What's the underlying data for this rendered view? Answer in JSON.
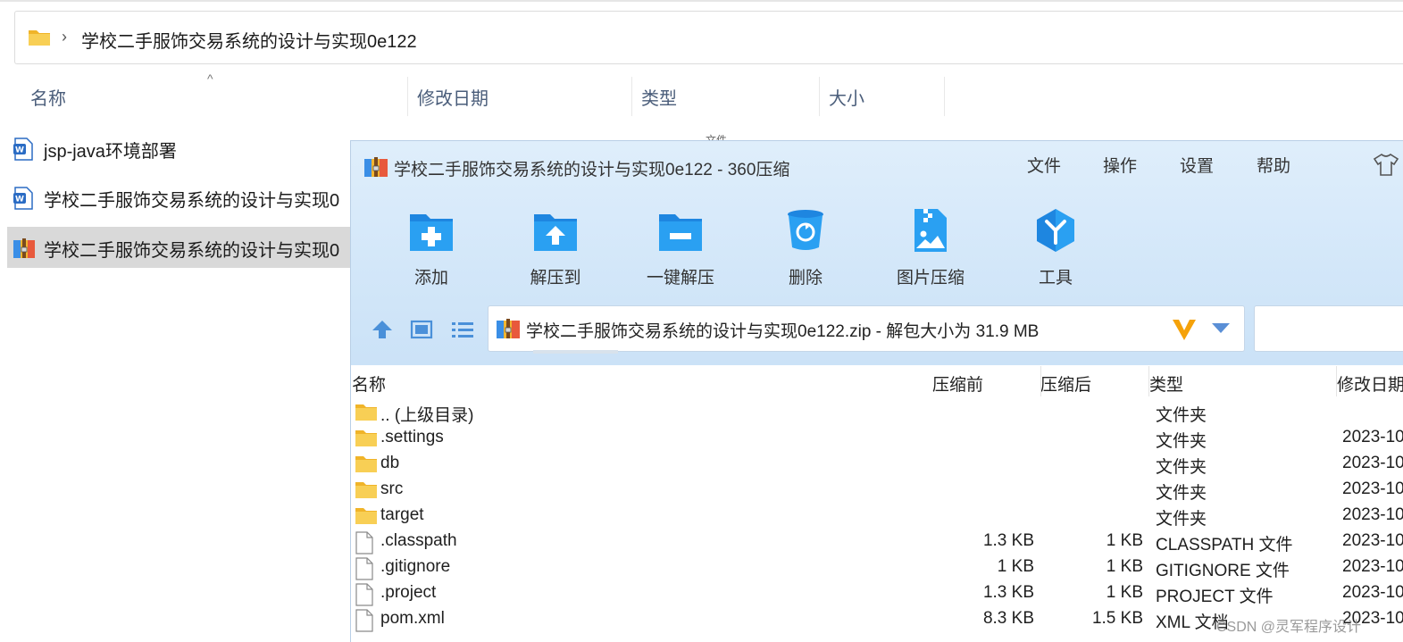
{
  "explorer": {
    "breadcrumb_path": "学校二手服饰交易系统的设计与实现0e122",
    "breadcrumb_separator": "›",
    "columns": {
      "name": "名称",
      "modified": "修改日期",
      "type": "类型",
      "size": "大小"
    },
    "sort_indicator": "^",
    "rows": [
      {
        "icon": "word-doc-icon",
        "name": "jsp-java环境部署",
        "selected": false
      },
      {
        "icon": "word-doc-icon",
        "name": "学校二手服饰交易系统的设计与实现0",
        "selected": false
      },
      {
        "icon": "zip-archive-icon",
        "name": "学校二手服饰交易系统的设计与实现0",
        "selected": true
      }
    ],
    "stray_text": "文件"
  },
  "zip_window": {
    "title": "学校二手服饰交易系统的设计与实现0e122 - 360压缩",
    "menu": {
      "file": "文件",
      "operate": "操作",
      "settings": "设置",
      "help": "帮助"
    },
    "toolbar": {
      "add": "添加",
      "extract_to": "解压到",
      "one_click_extract": "一键解压",
      "delete": "删除",
      "image_compress": "图片压缩",
      "tools": "工具"
    },
    "address": "学校二手服饰交易系统的设计与实现0e122.zip - 解包大小为 31.9 MB",
    "columns": {
      "name": "名称",
      "before": "压缩前",
      "after": "压缩后",
      "type": "类型",
      "modified": "修改日期"
    },
    "files": [
      {
        "kind": "folder",
        "name": ".. (上级目录)",
        "before": "",
        "after": "",
        "type": "文件夹",
        "modified": ""
      },
      {
        "kind": "folder",
        "name": ".settings",
        "before": "",
        "after": "",
        "type": "文件夹",
        "modified": "2023-10"
      },
      {
        "kind": "folder",
        "name": "db",
        "before": "",
        "after": "",
        "type": "文件夹",
        "modified": "2023-10"
      },
      {
        "kind": "folder",
        "name": "src",
        "before": "",
        "after": "",
        "type": "文件夹",
        "modified": "2023-10"
      },
      {
        "kind": "folder",
        "name": "target",
        "before": "",
        "after": "",
        "type": "文件夹",
        "modified": "2023-10"
      },
      {
        "kind": "file",
        "name": ".classpath",
        "before": "1.3 KB",
        "after": "1 KB",
        "type": "CLASSPATH 文件",
        "modified": "2023-10"
      },
      {
        "kind": "file",
        "name": ".gitignore",
        "before": "1 KB",
        "after": "1 KB",
        "type": "GITIGNORE 文件",
        "modified": "2023-10"
      },
      {
        "kind": "file",
        "name": ".project",
        "before": "1.3 KB",
        "after": "1 KB",
        "type": "PROJECT 文件",
        "modified": "2023-10"
      },
      {
        "kind": "file",
        "name": "pom.xml",
        "before": "8.3 KB",
        "after": "1.5 KB",
        "type": "XML 文档",
        "modified": "2023-10"
      }
    ]
  },
  "watermark": "CSDN @灵军程序设计",
  "colors": {
    "accent_blue": "#1e8be6",
    "folder_yellow": "#f5c54a",
    "header_bg": "#d3e7f9"
  }
}
